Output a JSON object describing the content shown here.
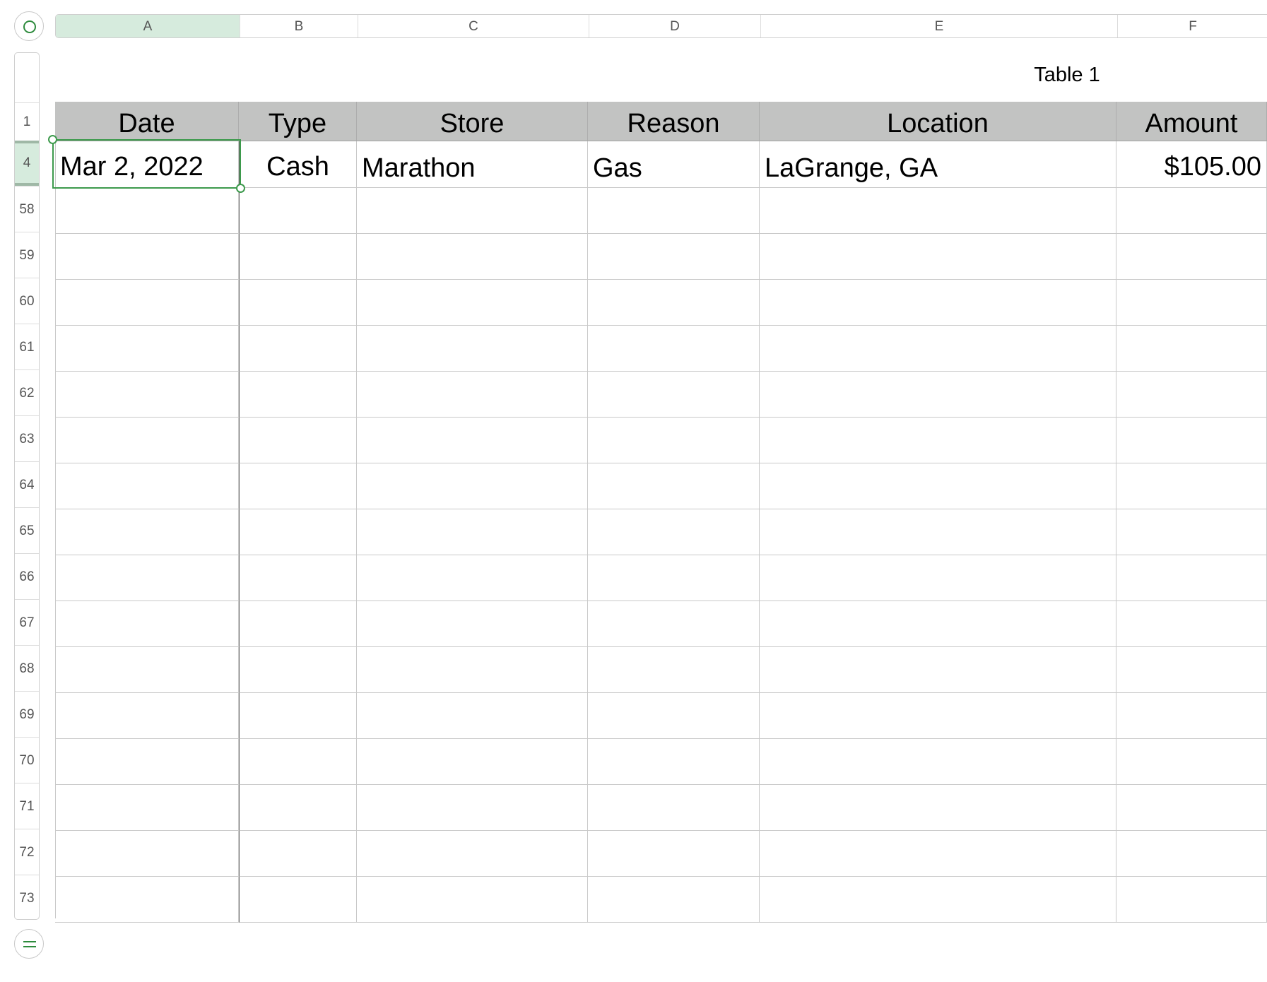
{
  "sheet": {
    "columns": [
      "A",
      "B",
      "C",
      "D",
      "E",
      "F"
    ],
    "selected_column": "A",
    "rows": [
      "1",
      "4",
      "58",
      "59",
      "60",
      "61",
      "62",
      "63",
      "64",
      "65",
      "66",
      "67",
      "68",
      "69",
      "70",
      "71",
      "72",
      "73"
    ],
    "selected_row": "4"
  },
  "table": {
    "title": "Table 1",
    "headers": [
      "Date",
      "Type",
      "Store",
      "Reason",
      "Location",
      "Amount"
    ],
    "data_row": {
      "date": "Mar 2, 2022",
      "type": "Cash",
      "store": "Marathon",
      "reason": "Gas",
      "location": "LaGrange, GA",
      "amount": "$105.00"
    },
    "selected_cell": "A4"
  },
  "colors": {
    "accent": "#3d9a4c",
    "header_fill": "#c2c3c2",
    "selection_fill": "#d6ebdd"
  },
  "icons": {
    "select_all": "circle-select-icon",
    "add_rows": "equals-handle-icon"
  }
}
